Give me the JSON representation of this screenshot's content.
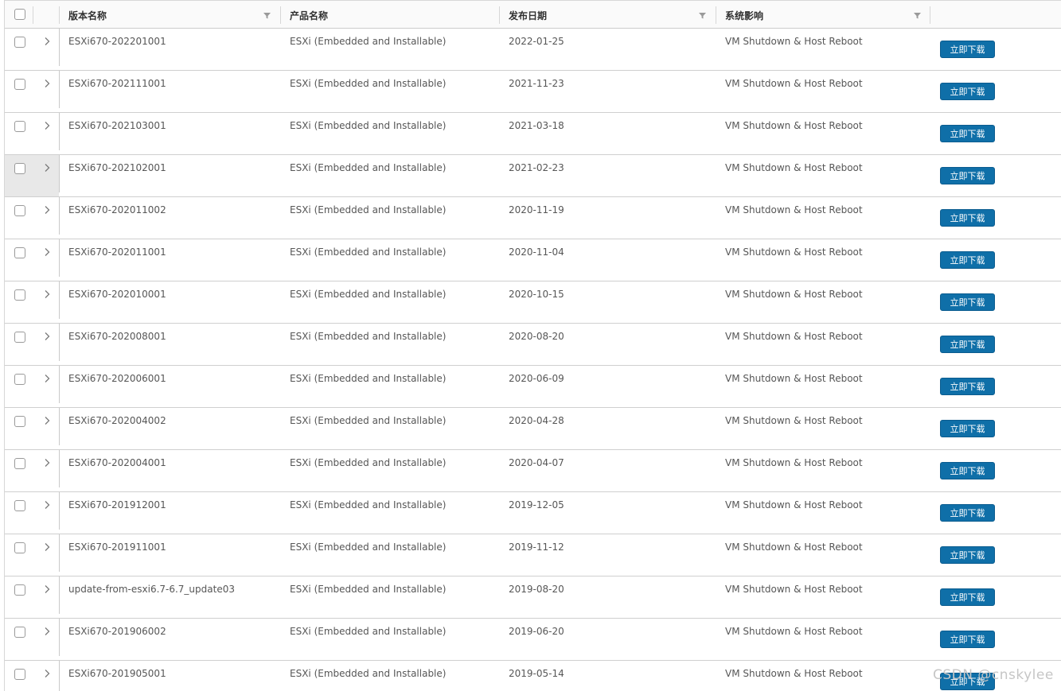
{
  "header": {
    "col_version": "版本名称",
    "col_product": "产品名称",
    "col_date": "发布日期",
    "col_impact": "系统影响"
  },
  "rows": [
    {
      "version": "ESXi670-202201001",
      "product": "ESXi (Embedded and Installable)",
      "date": "2022-01-25",
      "impact": "VM Shutdown & Host Reboot",
      "button": "立即下载"
    },
    {
      "version": "ESXi670-202111001",
      "product": "ESXi (Embedded and Installable)",
      "date": "2021-11-23",
      "impact": "VM Shutdown & Host Reboot",
      "button": "立即下载"
    },
    {
      "version": "ESXi670-202103001",
      "product": "ESXi (Embedded and Installable)",
      "date": "2021-03-18",
      "impact": "VM Shutdown & Host Reboot",
      "button": "立即下载"
    },
    {
      "version": "ESXi670-202102001",
      "product": "ESXi (Embedded and Installable)",
      "date": "2021-02-23",
      "impact": "VM Shutdown & Host Reboot",
      "button": "立即下载"
    },
    {
      "version": "ESXi670-202011002",
      "product": "ESXi (Embedded and Installable)",
      "date": "2020-11-19",
      "impact": "VM Shutdown & Host Reboot",
      "button": "立即下载"
    },
    {
      "version": "ESXi670-202011001",
      "product": "ESXi (Embedded and Installable)",
      "date": "2020-11-04",
      "impact": "VM Shutdown & Host Reboot",
      "button": "立即下载"
    },
    {
      "version": "ESXi670-202010001",
      "product": "ESXi (Embedded and Installable)",
      "date": "2020-10-15",
      "impact": "VM Shutdown & Host Reboot",
      "button": "立即下载"
    },
    {
      "version": "ESXi670-202008001",
      "product": "ESXi (Embedded and Installable)",
      "date": "2020-08-20",
      "impact": "VM Shutdown & Host Reboot",
      "button": "立即下载"
    },
    {
      "version": "ESXi670-202006001",
      "product": "ESXi (Embedded and Installable)",
      "date": "2020-06-09",
      "impact": "VM Shutdown & Host Reboot",
      "button": "立即下载"
    },
    {
      "version": "ESXi670-202004002",
      "product": "ESXi (Embedded and Installable)",
      "date": "2020-04-28",
      "impact": "VM Shutdown & Host Reboot",
      "button": "立即下载"
    },
    {
      "version": "ESXi670-202004001",
      "product": "ESXi (Embedded and Installable)",
      "date": "2020-04-07",
      "impact": "VM Shutdown & Host Reboot",
      "button": "立即下载"
    },
    {
      "version": "ESXi670-201912001",
      "product": "ESXi (Embedded and Installable)",
      "date": "2019-12-05",
      "impact": "VM Shutdown & Host Reboot",
      "button": "立即下载"
    },
    {
      "version": "ESXi670-201911001",
      "product": "ESXi (Embedded and Installable)",
      "date": "2019-11-12",
      "impact": "VM Shutdown & Host Reboot",
      "button": "立即下载"
    },
    {
      "version": "update-from-esxi6.7-6.7_update03",
      "product": "ESXi (Embedded and Installable)",
      "date": "2019-08-20",
      "impact": "VM Shutdown & Host Reboot",
      "button": "立即下载"
    },
    {
      "version": "ESXi670-201906002",
      "product": "ESXi (Embedded and Installable)",
      "date": "2019-06-20",
      "impact": "VM Shutdown & Host Reboot",
      "button": "立即下载"
    },
    {
      "version": "ESXi670-201905001",
      "product": "ESXi (Embedded and Installable)",
      "date": "2019-05-14",
      "impact": "VM Shutdown & Host Reboot",
      "button": "立即下载"
    }
  ],
  "hovered_row": 3,
  "watermark": "CSDN @cnskylee",
  "colors": {
    "button": "#0f6fa8",
    "hover_cell": "#e8e8e8",
    "border": "#cfcfcf"
  }
}
